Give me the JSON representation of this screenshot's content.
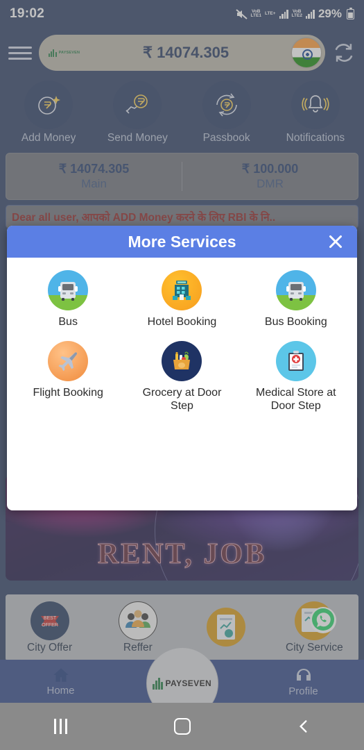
{
  "status_bar": {
    "time": "19:02",
    "sim1_label": "VoB",
    "sim1_net": "LTE1",
    "lte_plus": "LTE+",
    "sim2_label": "VoB",
    "sim2_net": "LTE2",
    "battery": "29%",
    "mute_icon": "mute-icon",
    "battery_icon": "battery-icon"
  },
  "header": {
    "menu_icon": "hamburger-menu-icon",
    "brand": "PAYSEVEN",
    "balance": "₹ 14074.305",
    "flag_icon": "india-flag-icon",
    "refresh_icon": "refresh-icon"
  },
  "quick_actions": [
    {
      "label": "Add Money",
      "icon": "add-money-icon"
    },
    {
      "label": "Send Money",
      "icon": "send-money-icon"
    },
    {
      "label": "Passbook",
      "icon": "passbook-icon"
    },
    {
      "label": "Notifications",
      "icon": "notification-bell-icon"
    }
  ],
  "balance_cards": [
    {
      "amount": "₹ 14074.305",
      "label": "Main"
    },
    {
      "amount": "₹ 100.000",
      "label": "DMR"
    }
  ],
  "marquee": {
    "text": "Dear all user, आपको ADD Money करने के लिए RBI के नि.."
  },
  "banner": {
    "text": "RENT, JOB"
  },
  "modal": {
    "title": "More Services",
    "close_icon": "close-icon",
    "header_color": "#5b7fe4",
    "services": [
      {
        "label": "Bus",
        "icon": "bus-icon"
      },
      {
        "label": "Hotel Booking",
        "icon": "hotel-icon"
      },
      {
        "label": "Bus Booking",
        "icon": "bus-icon"
      },
      {
        "label": "Flight Booking",
        "icon": "airplane-icon"
      },
      {
        "label": "Grocery at Door Step",
        "icon": "grocery-bag-icon"
      },
      {
        "label": "Medical Store at Door Step",
        "icon": "medical-clipboard-icon"
      }
    ]
  },
  "lower_row": [
    {
      "label": "City Offer",
      "icon": "best-offer-icon"
    },
    {
      "label": "Reffer",
      "icon": "people-group-icon"
    },
    {
      "label": "",
      "icon": "report-document-icon"
    },
    {
      "label": "City Service",
      "icon": "whatsapp-icon"
    }
  ],
  "fab": {
    "label": "PAYSEVEN",
    "icon": "payseven-logo-icon"
  },
  "bottom_nav": [
    {
      "label": "Home",
      "icon": "home-icon"
    },
    {
      "label": "Profile",
      "icon": "profile-icon"
    }
  ],
  "android_nav": {
    "recents_icon": "recents-icon",
    "home_icon": "android-home-icon",
    "back_icon": "back-icon"
  }
}
